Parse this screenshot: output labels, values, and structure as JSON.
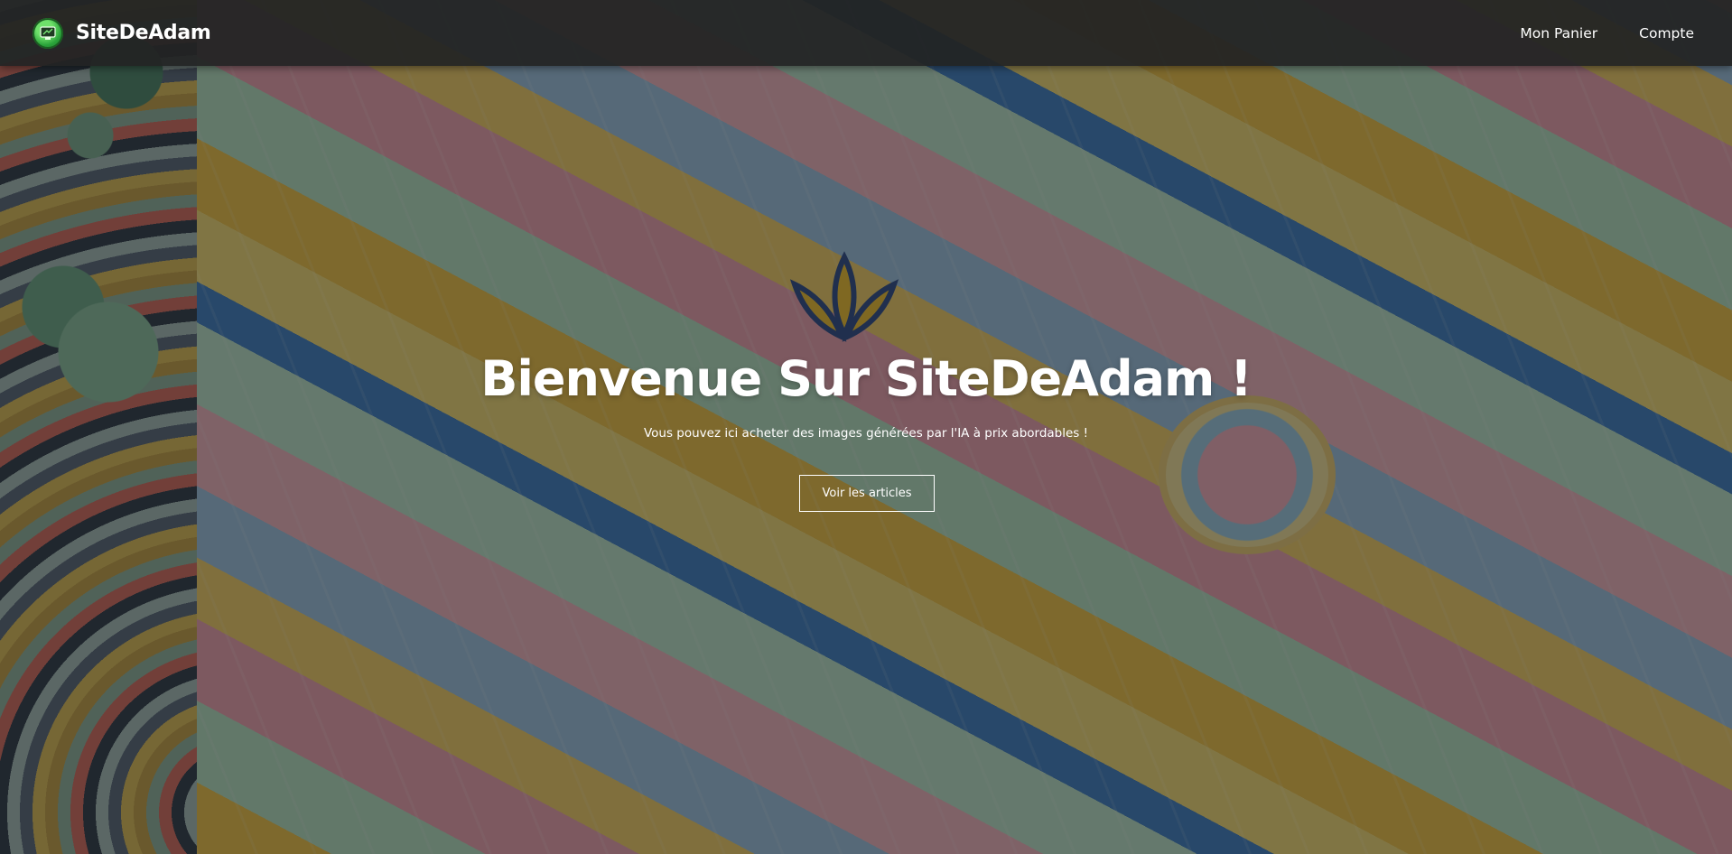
{
  "navbar": {
    "brand_name": "SiteDeAdam",
    "logo_icon": "monitor-logo-icon",
    "links": [
      {
        "label": "Mon Panier"
      },
      {
        "label": "Compte"
      }
    ]
  },
  "hero": {
    "title": "Bienvenue Sur SiteDeAdam !",
    "subtitle": "Vous pouvez ici acheter des images générées par l'IA à prix abordables !",
    "button_label": "Voir les articles"
  },
  "colors": {
    "navbar_bg": "#222424",
    "text": "#ffffff",
    "logo_green": "#2aa33a"
  }
}
